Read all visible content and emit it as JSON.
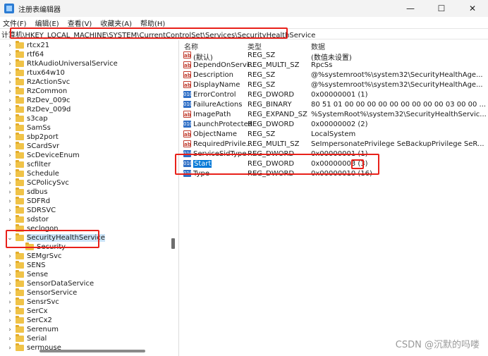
{
  "window": {
    "title": "注册表编辑器",
    "controls": {
      "minimize": "—",
      "maximize": "☐",
      "close": "✕"
    }
  },
  "menu": [
    "文件(F)",
    "编辑(E)",
    "查看(V)",
    "收藏夹(A)",
    "帮助(H)"
  ],
  "address": "计算机\\HKEY_LOCAL_MACHINE\\SYSTEM\\CurrentControlSet\\Services\\SecurityHealthService",
  "tree": {
    "items": [
      {
        "label": "rtcx21",
        "chevron": "›"
      },
      {
        "label": "rtf64",
        "chevron": "›"
      },
      {
        "label": "RtkAudioUniversalService",
        "chevron": "›"
      },
      {
        "label": "rtux64w10",
        "chevron": "›"
      },
      {
        "label": "RzActionSvc",
        "chevron": "›"
      },
      {
        "label": "RzCommon",
        "chevron": "›"
      },
      {
        "label": "RzDev_009c",
        "chevron": "›"
      },
      {
        "label": "RzDev_009d",
        "chevron": "›"
      },
      {
        "label": "s3cap",
        "chevron": "›"
      },
      {
        "label": "SamSs",
        "chevron": "›"
      },
      {
        "label": "sbp2port",
        "chevron": "›"
      },
      {
        "label": "SCardSvr",
        "chevron": "›"
      },
      {
        "label": "ScDeviceEnum",
        "chevron": "›"
      },
      {
        "label": "scfilter",
        "chevron": "›"
      },
      {
        "label": "Schedule",
        "chevron": "›"
      },
      {
        "label": "SCPolicySvc",
        "chevron": "›"
      },
      {
        "label": "sdbus",
        "chevron": "›"
      },
      {
        "label": "SDFRd",
        "chevron": "›"
      },
      {
        "label": "SDRSVC",
        "chevron": "›"
      },
      {
        "label": "sdstor",
        "chevron": "›"
      },
      {
        "label": "seclogon",
        "chevron": ""
      },
      {
        "label": "SecurityHealthService",
        "chevron": "⌄",
        "selected": true
      },
      {
        "label": "Security",
        "chevron": "",
        "child": true
      },
      {
        "label": "SEMgrSvc",
        "chevron": "›"
      },
      {
        "label": "SENS",
        "chevron": "›"
      },
      {
        "label": "Sense",
        "chevron": "›"
      },
      {
        "label": "SensorDataService",
        "chevron": "›"
      },
      {
        "label": "SensorService",
        "chevron": "›"
      },
      {
        "label": "SensrSvc",
        "chevron": "›"
      },
      {
        "label": "SerCx",
        "chevron": "›"
      },
      {
        "label": "SerCx2",
        "chevron": "›"
      },
      {
        "label": "Serenum",
        "chevron": "›"
      },
      {
        "label": "Serial",
        "chevron": "›"
      },
      {
        "label": "sermouse",
        "chevron": "›"
      }
    ]
  },
  "values": {
    "headers": {
      "name": "名称",
      "type": "类型",
      "data": "数据"
    },
    "rows": [
      {
        "icon": "ab",
        "icon_kind": "sz",
        "name": "(默认)",
        "type": "REG_SZ",
        "data": "(数值未设置)"
      },
      {
        "icon": "ab",
        "icon_kind": "sz",
        "name": "DependOnServi...",
        "type": "REG_MULTI_SZ",
        "data": "RpcSs"
      },
      {
        "icon": "ab",
        "icon_kind": "sz",
        "name": "Description",
        "type": "REG_SZ",
        "data": "@%systemroot%\\system32\\SecurityHealthAge..."
      },
      {
        "icon": "ab",
        "icon_kind": "sz",
        "name": "DisplayName",
        "type": "REG_SZ",
        "data": "@%systemroot%\\system32\\SecurityHealthAge..."
      },
      {
        "icon": "010",
        "icon_kind": "bin",
        "name": "ErrorControl",
        "type": "REG_DWORD",
        "data": "0x00000001 (1)"
      },
      {
        "icon": "010",
        "icon_kind": "bin",
        "name": "FailureActions",
        "type": "REG_BINARY",
        "data": "80 51 01 00 00 00 00 00 00 00 00 00 03 00 00 ..."
      },
      {
        "icon": "ab",
        "icon_kind": "sz",
        "name": "ImagePath",
        "type": "REG_EXPAND_SZ",
        "data": "%SystemRoot%\\system32\\SecurityHealthServic..."
      },
      {
        "icon": "010",
        "icon_kind": "bin",
        "name": "LaunchProtected",
        "type": "REG_DWORD",
        "data": "0x00000002 (2)"
      },
      {
        "icon": "ab",
        "icon_kind": "sz",
        "name": "ObjectName",
        "type": "REG_SZ",
        "data": "LocalSystem"
      },
      {
        "icon": "ab",
        "icon_kind": "sz",
        "name": "RequiredPrivile...",
        "type": "REG_MULTI_SZ",
        "data": "SeImpersonatePrivilege SeBackupPrivilege SeR..."
      },
      {
        "icon": "010",
        "icon_kind": "bin",
        "name": "ServiceSidType",
        "type": "REG_DWORD",
        "data": "0x00000001 (1)"
      },
      {
        "icon": "010",
        "icon_kind": "bin",
        "name": "Start",
        "type": "REG_DWORD",
        "data": "0x00000003 (3)",
        "selected": true
      },
      {
        "icon": "010",
        "icon_kind": "bin",
        "name": "Type",
        "type": "REG_DWORD",
        "data": "0x00000010 (16)"
      }
    ]
  },
  "watermark": "CSDN @沉默的吗喽",
  "colors": {
    "highlight_box": "#e8211a",
    "selection": "#0078d7",
    "tree_selection": "#cce4f7"
  }
}
